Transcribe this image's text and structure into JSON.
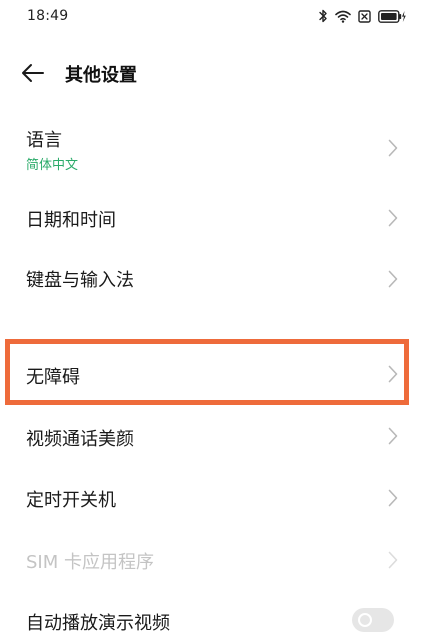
{
  "status_bar": {
    "time": "18:49",
    "icons": [
      "bluetooth-icon",
      "wifi-icon",
      "sim-card-icon",
      "battery-charging-icon"
    ]
  },
  "header": {
    "back_icon": "arrow-left-icon",
    "title": "其他设置"
  },
  "settings": {
    "items": [
      {
        "label": "语言",
        "sublabel": "简体中文",
        "enabled": true,
        "control": "chevron"
      },
      {
        "label": "日期和时间",
        "enabled": true,
        "control": "chevron"
      },
      {
        "label": "键盘与输入法",
        "enabled": true,
        "control": "chevron"
      },
      {
        "label": "无障碍",
        "enabled": true,
        "control": "chevron",
        "highlighted": true
      },
      {
        "label": "视频通话美颜",
        "enabled": true,
        "control": "chevron"
      },
      {
        "label": "定时开关机",
        "enabled": true,
        "control": "chevron"
      },
      {
        "label": "SIM 卡应用程序",
        "enabled": false,
        "control": "chevron"
      },
      {
        "label": "自动播放演示视频",
        "enabled": true,
        "control": "toggle",
        "toggle_on": false
      }
    ]
  },
  "colors": {
    "accent_green": "#2bab6a",
    "highlight_orange": "#ee6b3b",
    "disabled_text": "#c4c4c4",
    "chevron": "#b8b8b8"
  }
}
